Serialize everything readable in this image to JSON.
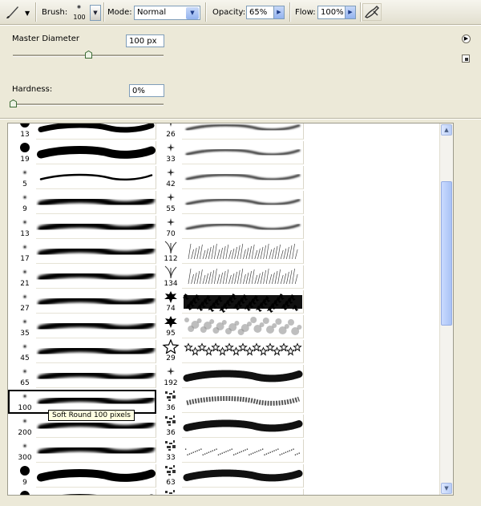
{
  "toolbar": {
    "brush_label": "Brush:",
    "brush_size": "100",
    "mode_label": "Mode:",
    "mode_value": "Normal",
    "opacity_label": "Opacity:",
    "opacity_value": "65%",
    "flow_label": "Flow:",
    "flow_value": "100%"
  },
  "options": {
    "master_diameter_label": "Master Diameter",
    "master_diameter_value": "100 px",
    "master_diameter_level": 0.5,
    "hardness_label": "Hardness:",
    "hardness_value": "0%",
    "hardness_level": 0
  },
  "brushes": {
    "left_column": [
      {
        "size": "13",
        "tip": "hard",
        "stroke": "hard-thin"
      },
      {
        "size": "19",
        "tip": "hard",
        "stroke": "hard"
      },
      {
        "size": "5",
        "tip": "soft",
        "stroke": "soft-thin"
      },
      {
        "size": "9",
        "tip": "soft",
        "stroke": "soft"
      },
      {
        "size": "13",
        "tip": "soft",
        "stroke": "soft"
      },
      {
        "size": "17",
        "tip": "soft",
        "stroke": "soft"
      },
      {
        "size": "21",
        "tip": "soft",
        "stroke": "soft"
      },
      {
        "size": "27",
        "tip": "soft",
        "stroke": "soft"
      },
      {
        "size": "35",
        "tip": "soft",
        "stroke": "soft"
      },
      {
        "size": "45",
        "tip": "soft",
        "stroke": "soft"
      },
      {
        "size": "65",
        "tip": "soft",
        "stroke": "soft"
      },
      {
        "size": "100",
        "tip": "soft",
        "stroke": "soft",
        "selected": true
      },
      {
        "size": "200",
        "tip": "soft",
        "stroke": "soft"
      },
      {
        "size": "300",
        "tip": "soft",
        "stroke": "soft"
      },
      {
        "size": "9",
        "tip": "hard",
        "stroke": "hard"
      },
      {
        "size": "",
        "tip": "hard",
        "stroke": "hard"
      }
    ],
    "right_column": [
      {
        "size": "26",
        "tip": "star",
        "stroke": "airbrush"
      },
      {
        "size": "33",
        "tip": "star",
        "stroke": "airbrush"
      },
      {
        "size": "42",
        "tip": "star",
        "stroke": "airbrush"
      },
      {
        "size": "55",
        "tip": "star",
        "stroke": "airbrush"
      },
      {
        "size": "70",
        "tip": "star",
        "stroke": "airbrush"
      },
      {
        "size": "112",
        "tip": "grass",
        "stroke": "grass"
      },
      {
        "size": "134",
        "tip": "grass",
        "stroke": "grass"
      },
      {
        "size": "74",
        "tip": "leaf",
        "stroke": "leaves"
      },
      {
        "size": "95",
        "tip": "leaf",
        "stroke": "bubbles"
      },
      {
        "size": "29",
        "tip": "star-outline",
        "stroke": "stars"
      },
      {
        "size": "192",
        "tip": "star",
        "stroke": "rough"
      },
      {
        "size": "36",
        "tip": "chalk",
        "stroke": "chalk"
      },
      {
        "size": "36",
        "tip": "chalk",
        "stroke": "rough"
      },
      {
        "size": "33",
        "tip": "chalk",
        "stroke": "spatter"
      },
      {
        "size": "63",
        "tip": "chalk",
        "stroke": "rough"
      },
      {
        "size": "",
        "tip": "chalk",
        "stroke": "airbrush"
      }
    ],
    "tooltip": "Soft Round 100 pixels"
  }
}
